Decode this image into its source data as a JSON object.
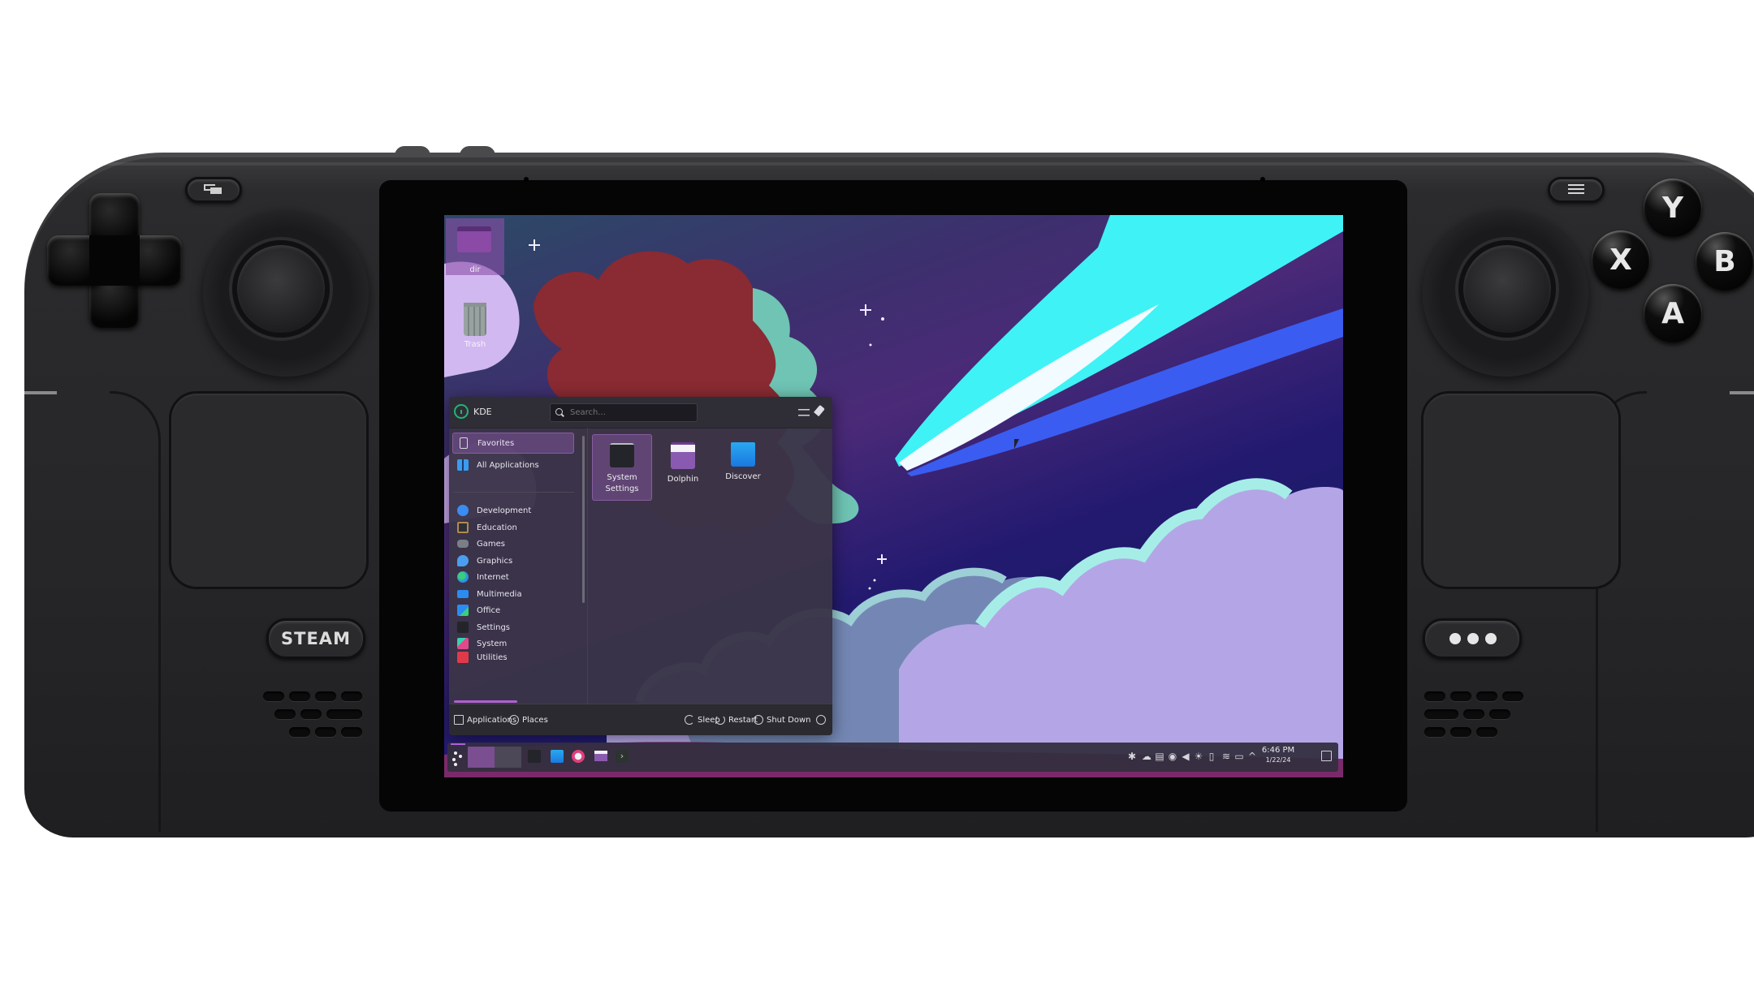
{
  "device": {
    "name": "Steam Deck",
    "buttons": {
      "steam": "STEAM",
      "quick_access": "•••",
      "face": {
        "y": "Y",
        "x": "X",
        "b": "B",
        "a": "A"
      },
      "view_icon": "view-icon",
      "menu_icon": "menu-icon"
    }
  },
  "desktop": {
    "icons": [
      {
        "label": "dir",
        "icon": "folder-icon"
      },
      {
        "label": "Trash",
        "icon": "trash-icon"
      }
    ],
    "wallpaper_colors": {
      "sky_top": "#2c4a66",
      "sky_mid": "#4b2a78",
      "sky_low": "#1e1a6a",
      "tree": "#8a2a32",
      "tree_highlight": "#6fc4b4",
      "comet": "#3ff2f6",
      "comet_blue": "#3b5cf0",
      "clouds": "#b4a6e6",
      "clouds_shadow": "#7487b4",
      "ground": "#7a2a6a"
    }
  },
  "kde_menu": {
    "user_label": "KDE",
    "search_placeholder": "Search...",
    "header_icons": [
      "configure-icon",
      "pin-icon"
    ],
    "categories": [
      {
        "label": "Favorites",
        "icon": "bookmark-icon",
        "active": true
      },
      {
        "label": "All Applications",
        "icon": "grid-icon",
        "active": false
      },
      {
        "label": "Development",
        "icon": "development-icon",
        "active": false
      },
      {
        "label": "Education",
        "icon": "education-icon",
        "active": false
      },
      {
        "label": "Games",
        "icon": "games-icon",
        "active": false
      },
      {
        "label": "Graphics",
        "icon": "graphics-icon",
        "active": false
      },
      {
        "label": "Internet",
        "icon": "internet-icon",
        "active": false
      },
      {
        "label": "Multimedia",
        "icon": "multimedia-icon",
        "active": false
      },
      {
        "label": "Office",
        "icon": "office-icon",
        "active": false
      },
      {
        "label": "Settings",
        "icon": "settings-icon",
        "active": false
      },
      {
        "label": "System",
        "icon": "system-icon",
        "active": false
      },
      {
        "label": "Utilities",
        "icon": "utilities-icon",
        "active": false
      }
    ],
    "favorites": [
      {
        "label": "System Settings",
        "icon": "system-settings-icon",
        "active": true
      },
      {
        "label": "Dolphin",
        "icon": "dolphin-folder-icon",
        "active": false
      },
      {
        "label": "Discover",
        "icon": "discover-bag-icon",
        "active": false
      }
    ],
    "footer": {
      "tabs": [
        {
          "label": "Applications",
          "icon": "applications-grid-icon",
          "active": true
        },
        {
          "label": "Places",
          "icon": "compass-icon",
          "active": false
        }
      ],
      "actions": [
        {
          "label": "Sleep",
          "icon": "sleep-icon"
        },
        {
          "label": "Restart",
          "icon": "restart-icon"
        },
        {
          "label": "Shut Down",
          "icon": "power-icon"
        }
      ],
      "more_icon": "chevron-left-circle-icon"
    },
    "accent": "#b05fd0"
  },
  "taskbar": {
    "launcher_icon": "kde-launcher-icon",
    "pager": [
      "Desktop 1",
      "Desktop 2"
    ],
    "pinned": [
      {
        "name": "System Settings",
        "icon": "system-settings-icon"
      },
      {
        "name": "Discover",
        "icon": "discover-bag-icon"
      },
      {
        "name": "Steam",
        "icon": "steam-icon"
      },
      {
        "name": "Dolphin",
        "icon": "dolphin-folder-icon"
      },
      {
        "name": "Konsole",
        "icon": "terminal-icon"
      }
    ],
    "tray": [
      "notifications-icon",
      "cloud-sync-icon",
      "clipboard-icon",
      "media-player-icon",
      "volume-icon",
      "brightness-icon",
      "device-icon",
      "wifi-icon",
      "battery-icon",
      "expand-tray-icon"
    ],
    "clock": {
      "time": "6:46 PM",
      "date": "1/22/24"
    },
    "show_desktop_icon": "show-desktop-icon"
  }
}
